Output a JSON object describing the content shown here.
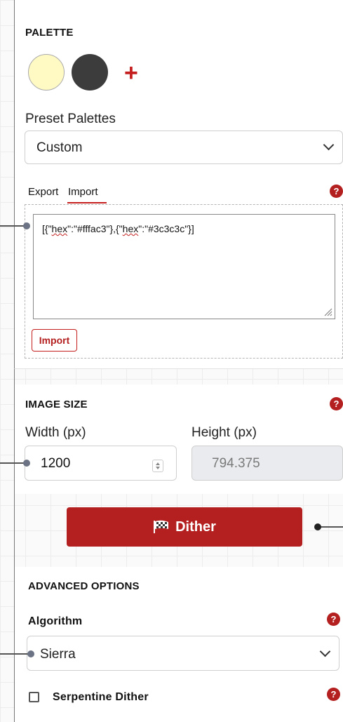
{
  "palette": {
    "heading": "PALETTE",
    "swatches": [
      {
        "name": "swatch-light-yellow",
        "color": "#fffac3"
      },
      {
        "name": "swatch-dark-gray",
        "color": "#3c3c3c"
      }
    ],
    "add_label": "+",
    "preset_label": "Preset Palettes",
    "preset_value": "Custom",
    "tabs": [
      "Export",
      "Import"
    ],
    "active_tab": "Import",
    "help": "?",
    "import_text_parts": [
      "[{\"",
      "hex",
      "\":\"#fffac3\"},{\"",
      "hex",
      "\":\"#3c3c3c\"}]"
    ],
    "import_button": "Import"
  },
  "image_size": {
    "heading": "IMAGE SIZE",
    "help": "?",
    "width_label": "Width (px)",
    "width_value": "1200",
    "height_label": "Height (px)",
    "height_value": "794.375"
  },
  "dither_button": "Dither",
  "advanced": {
    "heading": "ADVANCED OPTIONS",
    "algorithm_label": "Algorithm",
    "algorithm_value": "Sierra",
    "help": "?",
    "serpentine_label": "Serpentine Dither",
    "serpentine_checked": false
  },
  "colors": {
    "accent": "#b41f1f"
  }
}
